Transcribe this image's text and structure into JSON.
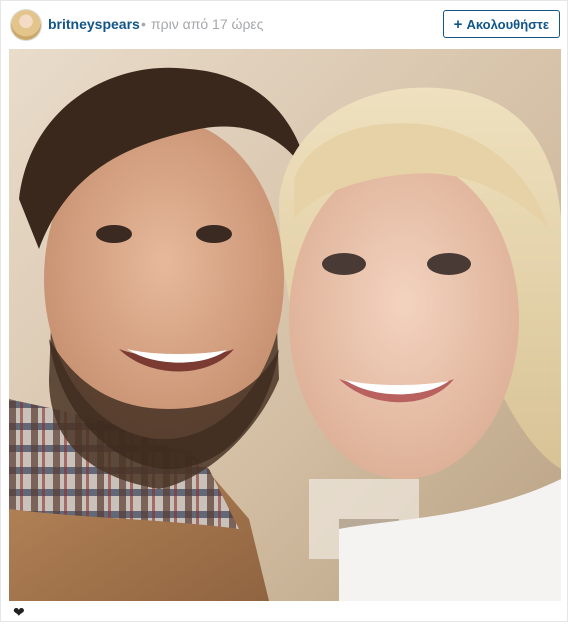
{
  "post": {
    "username": "britneyspears",
    "separator": "•",
    "time_ago": "πριν από 17 ώρες",
    "follow_label": "Ακολουθήστε",
    "follow_icon": "plus-icon",
    "like_icon": "heart-icon"
  },
  "colors": {
    "accent": "#125688",
    "muted": "#a5a7aa",
    "border": "#e6e6e6"
  }
}
